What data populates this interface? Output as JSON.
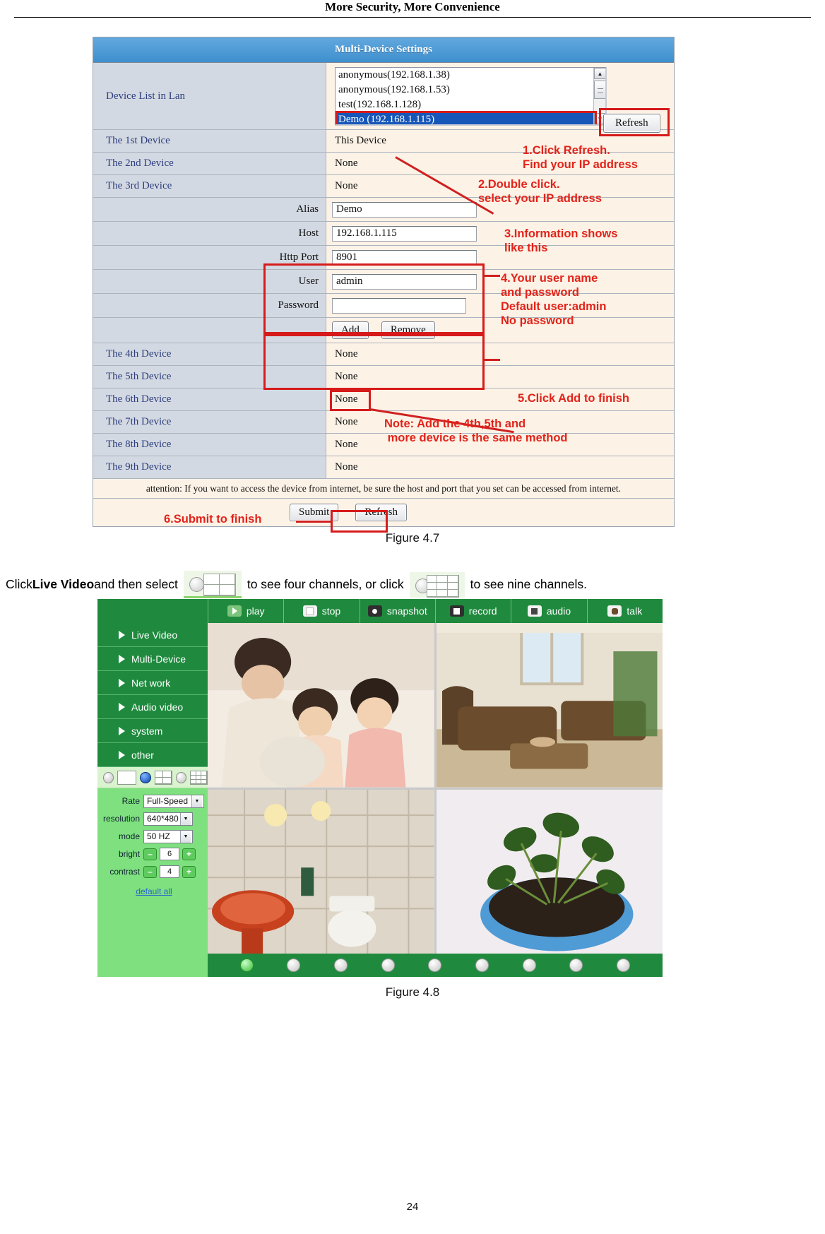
{
  "header": {
    "title": "More Security, More Convenience"
  },
  "figure47": {
    "title": "Multi-Device Settings",
    "device_list_label": "Device List in Lan",
    "device_list_options": [
      "anonymous(192.168.1.38)",
      "anonymous(192.168.1.53)",
      "test(192.168.1.128)",
      "Demo (192.168.1.115)"
    ],
    "device_list_selected": "Demo (192.168.1.115)",
    "refresh_top_label": "Refresh",
    "rows": [
      {
        "label": "The 1st Device",
        "value": "This Device"
      },
      {
        "label": "The 2nd Device",
        "value": "None"
      },
      {
        "label": "The 3rd Device",
        "value": "None"
      }
    ],
    "fields": [
      {
        "label": "Alias",
        "value": "Demo"
      },
      {
        "label": "Host",
        "value": "192.168.1.115"
      },
      {
        "label": "Http Port",
        "value": "8901"
      },
      {
        "label": "User",
        "value": "admin"
      },
      {
        "label": "Password",
        "value": ""
      }
    ],
    "add_label": "Add",
    "remove_label": "Remove",
    "rows2": [
      {
        "label": "The 4th Device",
        "value": "None"
      },
      {
        "label": "The 5th Device",
        "value": "None"
      },
      {
        "label": "The 6th Device",
        "value": "None"
      },
      {
        "label": "The 7th Device",
        "value": "None"
      },
      {
        "label": "The 8th Device",
        "value": "None"
      },
      {
        "label": "The 9th Device",
        "value": "None"
      }
    ],
    "attention": "attention: If you want to access the device from internet, be sure the host and port that you set can be accessed from internet.",
    "submit_label": "Submit",
    "refresh_bottom_label": "Refresh",
    "annotations": {
      "a1": "1.Click Refresh.\nFind your IP address",
      "a2": "2.Double click.\nselect your IP address",
      "a3": "3.Information shows\nlike this",
      "a4": "4.Your user name\nand password\nDefault user:admin\nNo password",
      "a5": "5.Click Add to finish",
      "a6": "Note: Add the 4th,5th and\n more device is the same method",
      "a7": "6.Submit to finish"
    },
    "accent_red": "#e2231a"
  },
  "caption47": "Figure 4.7",
  "sentence": {
    "p1": "Click ",
    "bold": "Live Video",
    "p2": " and then select ",
    "p3": " to see four channels, or click ",
    "p4": " to see nine channels."
  },
  "figure48": {
    "toolbar": [
      {
        "label": "play",
        "icon": "play-icon"
      },
      {
        "label": "stop",
        "icon": "stop-icon"
      },
      {
        "label": "snapshot",
        "icon": "camera-icon"
      },
      {
        "label": "record",
        "icon": "video-camera-icon"
      },
      {
        "label": "audio",
        "icon": "speaker-icon"
      },
      {
        "label": "talk",
        "icon": "microphone-icon"
      }
    ],
    "nav": [
      {
        "label": "Live Video"
      },
      {
        "label": "Multi-Device"
      },
      {
        "label": "Net work"
      },
      {
        "label": "Audio video"
      },
      {
        "label": "system"
      },
      {
        "label": "other"
      }
    ],
    "controls": [
      {
        "label": "Rate",
        "type": "select",
        "value": "Full-Speed"
      },
      {
        "label": "resolution",
        "type": "select",
        "value": "640*480"
      },
      {
        "label": "mode",
        "type": "select",
        "value": "50 HZ"
      },
      {
        "label": "bright",
        "type": "stepper",
        "value": "6"
      },
      {
        "label": "contrast",
        "type": "stepper",
        "value": "4"
      }
    ],
    "default_all": "default all",
    "minus": "–",
    "plus": "+",
    "green": "#1f8a3e"
  },
  "caption48": "Figure 4.8",
  "page_number": "24"
}
